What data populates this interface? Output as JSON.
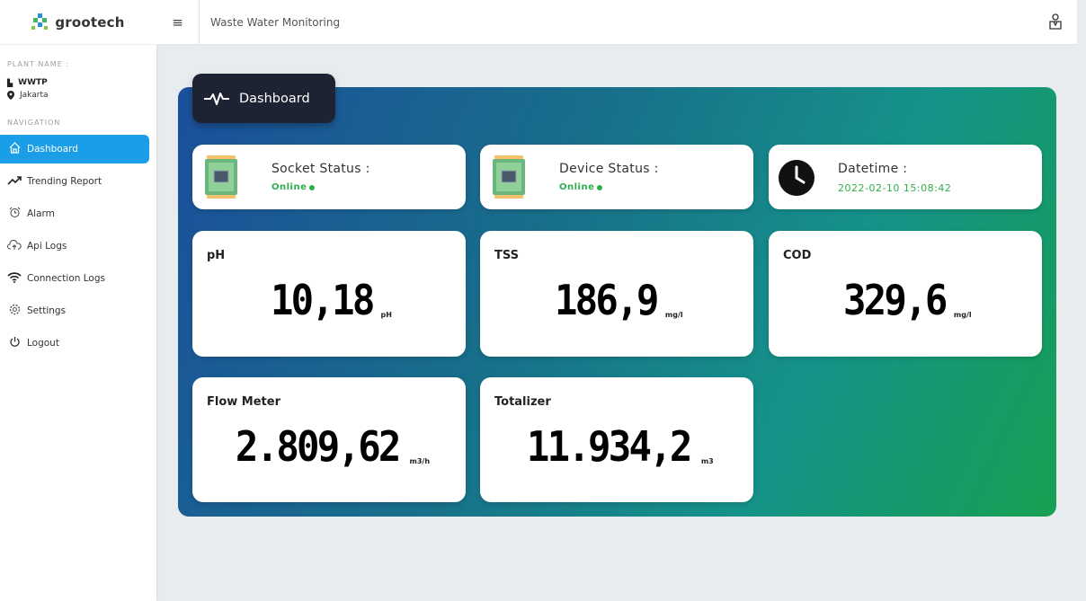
{
  "brand": {
    "name": "grootech"
  },
  "sidebar": {
    "plant_label": "PLANT NAME :",
    "plant_name": "WWTP",
    "plant_location": "Jakarta",
    "nav_label": "NAVIGATION",
    "items": [
      {
        "label": "Dashboard",
        "icon": "home-icon",
        "active": true
      },
      {
        "label": "Trending Report",
        "icon": "trending-icon"
      },
      {
        "label": "Alarm",
        "icon": "alarm-icon"
      },
      {
        "label": "Api Logs",
        "icon": "cloud-upload-icon"
      },
      {
        "label": "Connection Logs",
        "icon": "wifi-icon"
      },
      {
        "label": "Settings",
        "icon": "gear-icon"
      },
      {
        "label": "Logout",
        "icon": "power-icon"
      }
    ]
  },
  "topbar": {
    "title": "Waste Water Monitoring"
  },
  "dashboard": {
    "tab_label": "Dashboard"
  },
  "status": {
    "socket": {
      "title": "Socket Status :",
      "value": "Online"
    },
    "device": {
      "title": "Device Status :",
      "value": "Online"
    },
    "datetime": {
      "title": "Datetime :",
      "value": "2022-02-10 15:08:42"
    }
  },
  "metrics": {
    "ph": {
      "label": "pH",
      "value": "10,18",
      "unit": "pH"
    },
    "tss": {
      "label": "TSS",
      "value": "186,9",
      "unit": "mg/l"
    },
    "cod": {
      "label": "COD",
      "value": "329,6",
      "unit": "mg/l"
    },
    "flow": {
      "label": "Flow Meter",
      "value": "2.809,62",
      "unit": "m3/h"
    },
    "totalizer": {
      "label": "Totalizer",
      "value": "11.934,2",
      "unit": "m3"
    }
  },
  "colors": {
    "accent": "#1a9ee8",
    "online": "#2db04b",
    "tab_bg": "#1d2333"
  }
}
